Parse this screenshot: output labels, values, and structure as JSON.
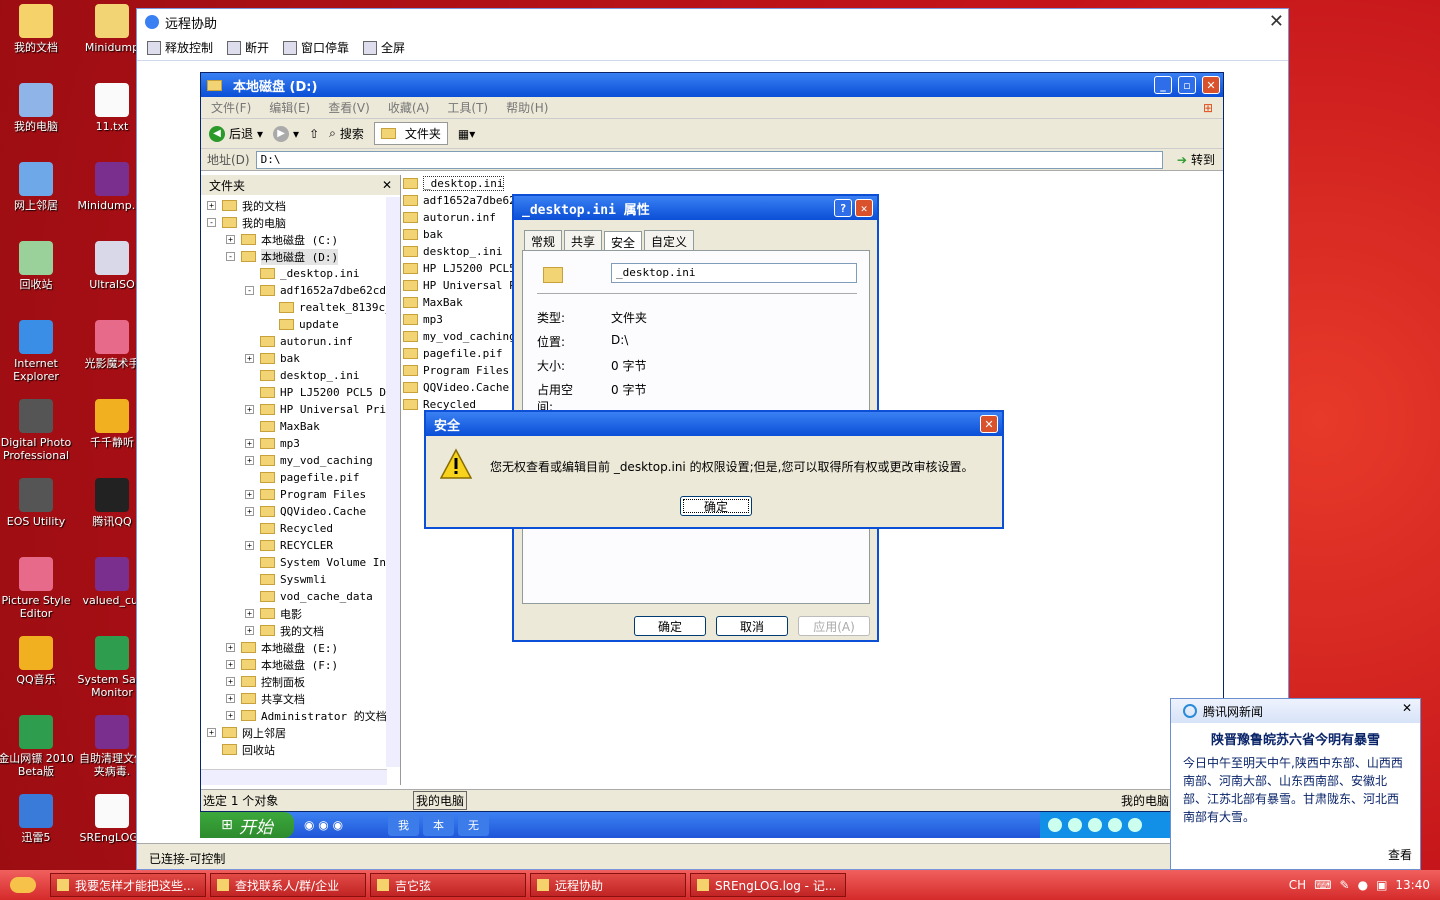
{
  "desktop_icons": [
    {
      "label": "我的文档",
      "icon": "my-documents-icon"
    },
    {
      "label": "Minidump",
      "icon": "folder-icon"
    },
    {
      "label": "我的电脑",
      "icon": "my-computer-icon"
    },
    {
      "label": "11.txt",
      "icon": "text-file-icon"
    },
    {
      "label": "网上邻居",
      "icon": "network-icon"
    },
    {
      "label": "Minidump.ra",
      "icon": "rar-icon"
    },
    {
      "label": "回收站",
      "icon": "recycle-bin-icon"
    },
    {
      "label": "UltraISO",
      "icon": "disc-icon"
    },
    {
      "label": "Internet Explorer",
      "icon": "ie-icon"
    },
    {
      "label": "光影魔术手",
      "icon": "app-icon"
    },
    {
      "label": "Digital Photo Professional",
      "icon": "camera-icon"
    },
    {
      "label": "千千静听",
      "icon": "music-icon"
    },
    {
      "label": "EOS Utility",
      "icon": "camera-icon"
    },
    {
      "label": "腾讯QQ",
      "icon": "qq-icon"
    },
    {
      "label": "Picture Style Editor",
      "icon": "app-icon"
    },
    {
      "label": "valued_cu.",
      "icon": "rar-icon"
    },
    {
      "label": "QQ音乐",
      "icon": "music-icon"
    },
    {
      "label": "System Safe Monitor",
      "icon": "shield-icon"
    },
    {
      "label": "金山网镖 2010 Beta版",
      "icon": "shield-icon"
    },
    {
      "label": "自助清理文件夹病毒.",
      "icon": "rar-icon"
    },
    {
      "label": "迅雷5",
      "icon": "thunder-icon"
    },
    {
      "label": "SREngLOG.l",
      "icon": "text-file-icon"
    }
  ],
  "remote": {
    "title": "远程协助",
    "toolbar": [
      "释放控制",
      "断开",
      "窗口停靠",
      "全屏"
    ],
    "status": "已连接-可控制"
  },
  "explorer": {
    "title": "本地磁盘 (D:)",
    "menu": [
      "文件(F)",
      "编辑(E)",
      "查看(V)",
      "收藏(A)",
      "工具(T)",
      "帮助(H)"
    ],
    "back": "后退",
    "search": "搜索",
    "folders": "文件夹",
    "address_label": "地址(D)",
    "address": "D:\\",
    "go": "转到",
    "pane_title": "文件夹",
    "tree": [
      {
        "label": "我的文档",
        "indent": 0,
        "pm": "+"
      },
      {
        "label": "我的电脑",
        "indent": 0,
        "pm": "-"
      },
      {
        "label": "本地磁盘 (C:)",
        "indent": 1,
        "pm": "+"
      },
      {
        "label": "本地磁盘 (D:)",
        "indent": 1,
        "pm": "-"
      },
      {
        "label": "_desktop.ini",
        "indent": 2,
        "pm": ""
      },
      {
        "label": "adf1652a7dbe62cd0",
        "indent": 2,
        "pm": "-"
      },
      {
        "label": "realtek_8139c_",
        "indent": 3,
        "pm": ""
      },
      {
        "label": "update",
        "indent": 3,
        "pm": ""
      },
      {
        "label": "autorun.inf",
        "indent": 2,
        "pm": ""
      },
      {
        "label": "bak",
        "indent": 2,
        "pm": "+"
      },
      {
        "label": "desktop_.ini",
        "indent": 2,
        "pm": ""
      },
      {
        "label": "HP LJ5200 PCL5 Dr",
        "indent": 2,
        "pm": ""
      },
      {
        "label": "HP Universal Prin",
        "indent": 2,
        "pm": "+"
      },
      {
        "label": "MaxBak",
        "indent": 2,
        "pm": ""
      },
      {
        "label": "mp3",
        "indent": 2,
        "pm": "+"
      },
      {
        "label": "my_vod_caching",
        "indent": 2,
        "pm": "+"
      },
      {
        "label": "pagefile.pif",
        "indent": 2,
        "pm": ""
      },
      {
        "label": "Program Files",
        "indent": 2,
        "pm": "+"
      },
      {
        "label": "QQVideo.Cache",
        "indent": 2,
        "pm": "+"
      },
      {
        "label": "Recycled",
        "indent": 2,
        "pm": ""
      },
      {
        "label": "RECYCLER",
        "indent": 2,
        "pm": "+"
      },
      {
        "label": "System Volume Inf",
        "indent": 2,
        "pm": ""
      },
      {
        "label": "Syswmli",
        "indent": 2,
        "pm": ""
      },
      {
        "label": "vod_cache_data",
        "indent": 2,
        "pm": ""
      },
      {
        "label": "电影",
        "indent": 2,
        "pm": "+"
      },
      {
        "label": "我的文档",
        "indent": 2,
        "pm": "+"
      },
      {
        "label": "本地磁盘 (E:)",
        "indent": 1,
        "pm": "+"
      },
      {
        "label": "本地磁盘 (F:)",
        "indent": 1,
        "pm": "+"
      },
      {
        "label": "控制面板",
        "indent": 1,
        "pm": "+"
      },
      {
        "label": "共享文档",
        "indent": 1,
        "pm": "+"
      },
      {
        "label": "Administrator 的文档",
        "indent": 1,
        "pm": "+"
      },
      {
        "label": "网上邻居",
        "indent": 0,
        "pm": "+"
      },
      {
        "label": "回收站",
        "indent": 0,
        "pm": ""
      }
    ],
    "files": [
      "_desktop.ini",
      "adf1652a7dbe62c",
      "autorun.inf",
      "bak",
      "desktop_.ini",
      "HP LJ5200 PCL5",
      "HP Universal Pr",
      "MaxBak",
      "mp3",
      "my_vod_caching",
      "pagefile.pif",
      "Program Files",
      "QQVideo.Cache",
      "Recycled"
    ],
    "status_left": "选定 1 个对象",
    "status_mid": "我的电脑",
    "status_right": "我的电脑"
  },
  "properties": {
    "title": "_desktop.ini 属性",
    "tabs": [
      "常规",
      "共享",
      "安全",
      "自定义"
    ],
    "name": "_desktop.ini",
    "rows": [
      {
        "k": "类型:",
        "v": "文件夹"
      },
      {
        "k": "位置:",
        "v": "D:\\"
      },
      {
        "k": "大小:",
        "v": "0 字节"
      },
      {
        "k": "占用空间:",
        "v": "0 字节"
      }
    ],
    "ok": "确定",
    "cancel": "取消",
    "apply": "应用(A)"
  },
  "security": {
    "title": "安全",
    "message": "您无权查看或编辑目前 _desktop.ini 的权限设置;但是,您可以取得所有权或更改审核设置。",
    "ok": "确定"
  },
  "inner_taskbar": {
    "start": "开始",
    "buttons": [
      "我",
      "本",
      "无"
    ]
  },
  "news": {
    "header": "腾讯网新闻",
    "title": "陕晋豫鲁皖苏六省今明有暴雪",
    "body": "今日中午至明天中午,陕西中东部、山西西南部、河南大部、山东西南部、安徽北部、江苏北部有暴雪。甘肃陇东、河北西南部有大雪。",
    "more": "查看"
  },
  "taskbar": {
    "buttons": [
      "我要怎样才能把这些...",
      "查找联系人/群/企业",
      "吉它弦",
      "远程协助",
      "SREngLOG.log - 记..."
    ],
    "tray_lang": "CH",
    "clock": "13:40"
  },
  "colors": {
    "xp_blue": "#0a4fd6",
    "desktop_red": "#c4141a",
    "dialog_bg": "#ece9d8"
  }
}
